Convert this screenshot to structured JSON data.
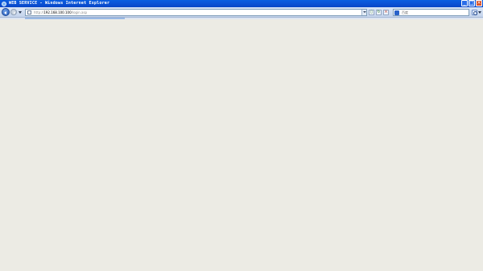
{
  "window": {
    "title": "WEB SERVICE - Windows Internet Explorer"
  },
  "caption_buttons": {
    "minimize_glyph": "_",
    "maximize_glyph": "□",
    "close_glyph": "×"
  },
  "navigation": {
    "back_icon": "back-arrow-icon",
    "forward_icon": "forward-arrow-icon",
    "recent_pages_icon": "chevron-down-icon"
  },
  "address_bar": {
    "scheme": "http://",
    "host": "192.168.100.100",
    "path": "/login.asp",
    "page_icon": "page-icon"
  },
  "toolbar": {
    "compat_glyph": "▯",
    "refresh_glyph": "↻",
    "stop_glyph": "×"
  },
  "search": {
    "placeholder": "百度",
    "engine_icon": "search-engine-icon"
  },
  "colors": {
    "titlebar": "#0b55d8",
    "navbar": "#c4d4ec",
    "content_background": "#ecebe4"
  }
}
